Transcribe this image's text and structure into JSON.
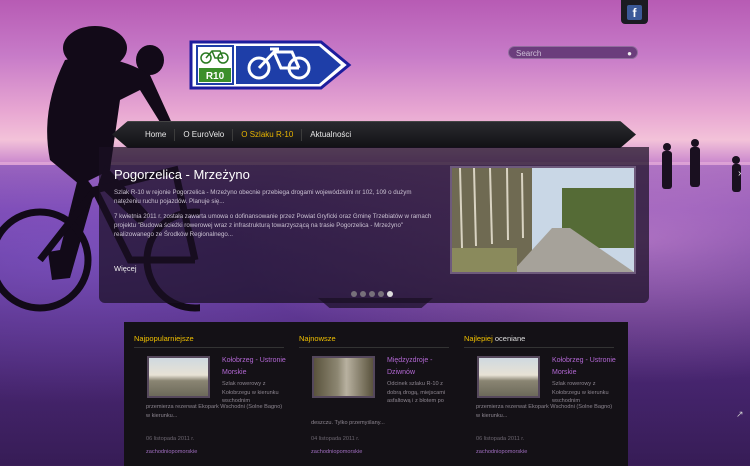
{
  "facebook": {
    "label": "f"
  },
  "logo": {
    "text": "R10"
  },
  "search": {
    "placeholder": "Search"
  },
  "nav": {
    "items": [
      "Home",
      "O EuroVelo",
      "O Szlaku R-10",
      "Aktualności"
    ]
  },
  "slide": {
    "title": "Pogorzelica - Mrzeżyno",
    "paragraph1": "Szlak R-10 w rejonie Pogorzelica - Mrzeżyno obecnie przebiega drogami wojewódzkimi nr 102, 109 o dużym natężeniu ruchu pojazdów. Planuje się...",
    "paragraph2": "7 kwietnia 2011 r. została zawarta umowa o dofinansowanie przez Powiat Gryficki oraz Gminę Trzebiatów w ramach projektu \"Budowa ścieżki rowerowej wraz z infrastrukturą towarzyszącą na trasie Pogorzelica - Mrzeżyno\" realizowanego ze Środków Regionalnego...",
    "more": "Więcej"
  },
  "dots": {
    "count": 5,
    "active": 5
  },
  "boxes": [
    {
      "heading_hl": "Najpopularniejsze",
      "heading_rest": "",
      "title": "Kołobrzeg - Ustronie Morskie",
      "desc": "Szlak rowerowy z Kołobrzegu w kierunku wschodnim",
      "desc2": "przemierza rezerwat Ekopark Wschodni (Solne Bagno) w kierunku...",
      "date": "06 listopada 2011 r.",
      "location": "zachodniopomorskie"
    },
    {
      "heading_hl": "Najnowsze",
      "heading_rest": "",
      "title": "Międzyzdroje - Dziwnów",
      "desc": "Odcinek szlaku R-10 z dobrą drogą, miejscami asfaltową i z błotem po",
      "desc2": "deszczu. Tylko przemyślany...",
      "date": "04 listopada 2011 r.",
      "location": "zachodniopomorskie"
    },
    {
      "heading_hl": "Najlepiej",
      "heading_rest": " oceniane",
      "title": "Kołobrzeg - Ustronie Morskie",
      "desc": "Szlak rowerowy z Kołobrzegu w kierunku wschodnim",
      "desc2": "przemierza rezerwat Ekopark Wschodni (Solne Bagno) w kierunku...",
      "date": "06 listopada 2011 r.",
      "location": "zachodniopomorskie"
    }
  ]
}
